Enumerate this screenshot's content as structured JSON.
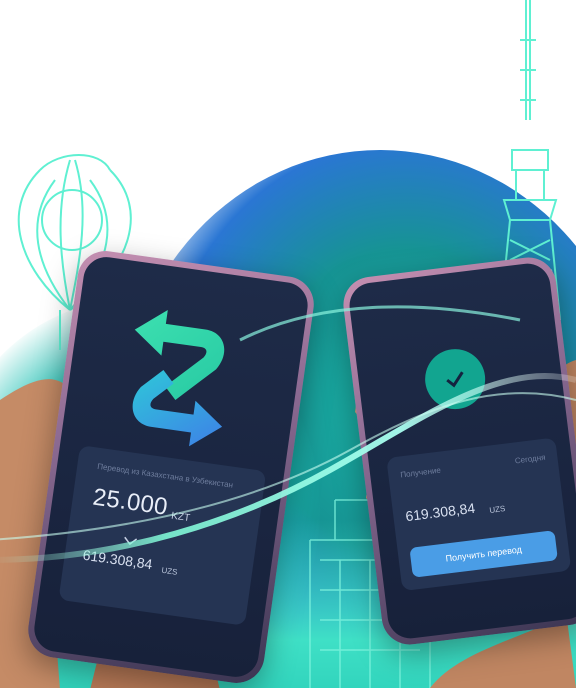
{
  "colors": {
    "teal": "#12a590",
    "screen": "#1e2b48",
    "card": "#253453",
    "button": "#4a9de6",
    "glow": "#3fe0c6"
  },
  "left_phone": {
    "icon": "transfer-arrows-icon",
    "card": {
      "caption": "Перевод из Казахстана в Узбекистан",
      "amount": "25.000",
      "currency": "KZT",
      "converted_amount": "619.308,84",
      "converted_currency": "UZS"
    }
  },
  "right_phone": {
    "icon": "checkmark-icon",
    "card": {
      "caption_left": "Получение",
      "caption_right": "Сегодня",
      "amount": "619.308,84",
      "currency": "UZS",
      "button_label": "Получить перевод"
    }
  }
}
